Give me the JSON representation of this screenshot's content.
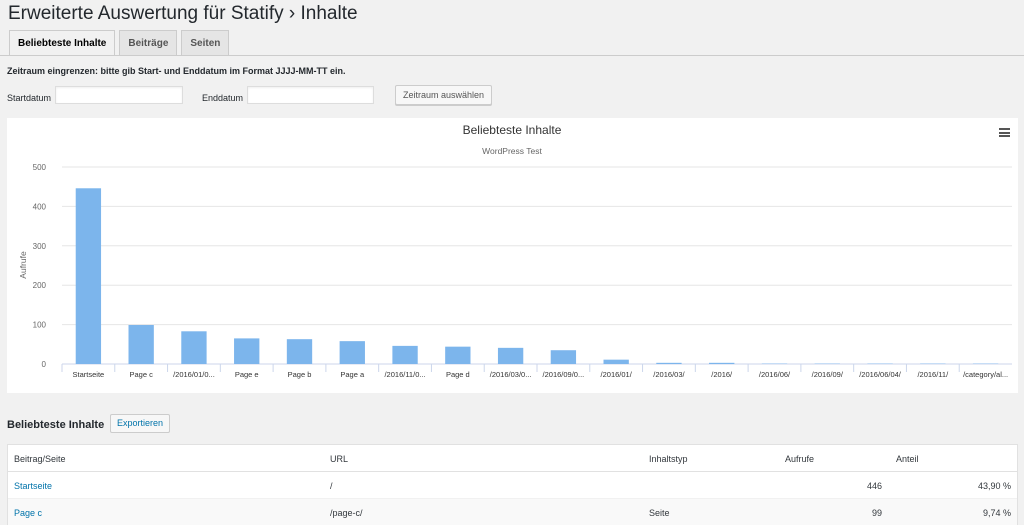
{
  "page": {
    "title": "Erweiterte Auswertung für Statify › Inhalte"
  },
  "tabs": [
    {
      "label": "Beliebteste Inhalte",
      "active": true
    },
    {
      "label": "Beiträge",
      "active": false
    },
    {
      "label": "Seiten",
      "active": false
    }
  ],
  "filter": {
    "instruction": "Zeitraum eingrenzen: bitte gib Start- und Enddatum im Format JJJJ-MM-TT ein.",
    "start_label": "Startdatum",
    "start_value": "",
    "end_label": "Enddatum",
    "end_value": "",
    "submit_label": "Zeitraum auswählen"
  },
  "chart_data": {
    "type": "bar",
    "title": "Beliebteste Inhalte",
    "subtitle": "WordPress Test",
    "ylabel": "Aufrufe",
    "xlabel": "",
    "ylim": [
      0,
      500
    ],
    "yticks": [
      0,
      100,
      200,
      300,
      400,
      500
    ],
    "grid": true,
    "bar_color": "#7cb5ec",
    "categories": [
      "Startseite",
      "Page c",
      "/2016/01/0...",
      "Page e",
      "Page b",
      "Page a",
      "/2016/11/0...",
      "Page d",
      "/2016/03/0...",
      "/2016/09/0...",
      "/2016/01/",
      "/2016/03/",
      "/2016/",
      "/2016/06/",
      "/2016/09/",
      "/2016/06/04/",
      "/2016/11/",
      "/category/al..."
    ],
    "values": [
      446,
      99,
      83,
      65,
      63,
      58,
      46,
      44,
      41,
      35,
      11,
      3,
      3,
      1,
      1,
      1,
      1,
      1
    ]
  },
  "table": {
    "title": "Beliebteste Inhalte",
    "export_label": "Exportieren",
    "columns": [
      "Beitrag/Seite",
      "URL",
      "Inhaltstyp",
      "Aufrufe",
      "Anteil"
    ],
    "rows": [
      {
        "title": "Startseite",
        "url": "/",
        "type": "",
        "views": "446",
        "share": "43,90 %"
      },
      {
        "title": "Page c",
        "url": "/page-c/",
        "type": "Seite",
        "views": "99",
        "share": "9,74 %"
      }
    ]
  }
}
